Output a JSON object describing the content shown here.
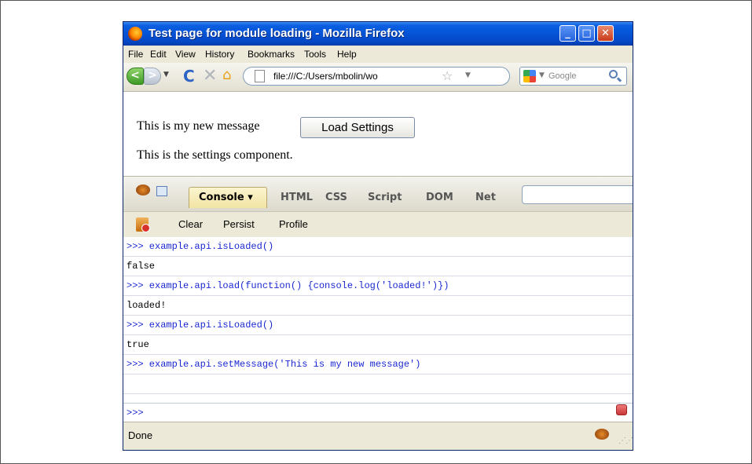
{
  "window": {
    "title": "Test page for module loading - Mozilla Firefox"
  },
  "title_buttons": {
    "minimize": "_",
    "maximize": "□",
    "close": "✕"
  },
  "menu": [
    "File",
    "Edit",
    "View",
    "History",
    "Bookmarks",
    "Tools",
    "Help"
  ],
  "navigation": {
    "back_glyph": "<",
    "forward_glyph": ">",
    "reload_glyph": "C",
    "stop_glyph": "✕",
    "home_glyph": "⌂",
    "url": "file:///C:/Users/mbolin/wo",
    "star_glyph": "☆",
    "search_placeholder": "Google"
  },
  "page": {
    "message": "This is my new message",
    "load_button": "Load Settings",
    "settings_text": "This is the settings component."
  },
  "firebug": {
    "tabs": {
      "console": "Console ▾",
      "html": "HTML",
      "css": "CSS",
      "script": "Script",
      "dom": "DOM",
      "net": "Net"
    },
    "toolbar": {
      "clear": "Clear",
      "persist": "Persist",
      "profile": "Profile"
    },
    "console_lines": [
      {
        "kind": "cmd",
        "text": ">>> example.api.isLoaded()"
      },
      {
        "kind": "out",
        "text": "false"
      },
      {
        "kind": "cmd",
        "text": ">>> example.api.load(function() {console.log('loaded!')})"
      },
      {
        "kind": "out",
        "text": "loaded!"
      },
      {
        "kind": "cmd",
        "text": ">>> example.api.isLoaded()"
      },
      {
        "kind": "out",
        "text": "true"
      },
      {
        "kind": "cmd",
        "text": ">>> example.api.setMessage('This is my new message')"
      },
      {
        "kind": "out",
        "text": ""
      }
    ],
    "prompt": ">>>"
  },
  "status": {
    "text": "Done"
  },
  "colors": {
    "titlebar": "#0553d6",
    "console_command": "#1a28d3",
    "console_tab": "#f2e4a4"
  }
}
